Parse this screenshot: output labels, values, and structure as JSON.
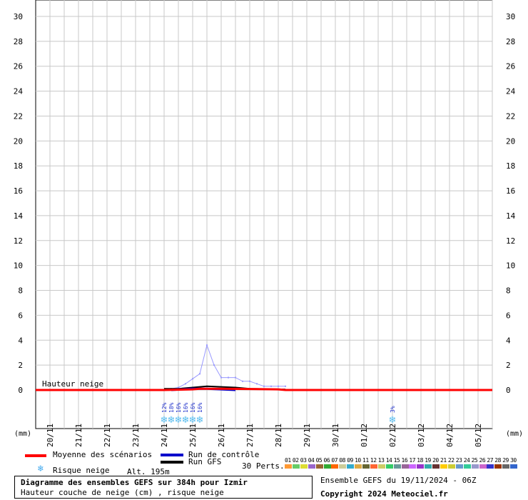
{
  "chart_data": {
    "type": "line",
    "title": "Diagramme des ensembles GEFS sur 384h pour Izmir",
    "subtitle": "Hauteur couche de neige (cm) , risque neige",
    "ylabel": "(mm)",
    "ylim": [
      0,
      30
    ],
    "yticks": [
      0,
      2,
      4,
      6,
      8,
      10,
      12,
      14,
      16,
      18,
      20,
      22,
      24,
      26,
      28,
      30
    ],
    "x_start_day": 19.5,
    "x_end_day": 35.5,
    "date_labels": [
      "20/11",
      "21/11",
      "22/11",
      "23/11",
      "24/11",
      "25/11",
      "26/11",
      "27/11",
      "28/11",
      "29/11",
      "30/11",
      "01/12",
      "02/12",
      "03/12",
      "04/12",
      "05/12"
    ],
    "inline_label": "Hauteur neige",
    "series": [
      {
        "name": "Moyenne des scénarios",
        "color": "#ff0000",
        "x": [
          19.5,
          24.0,
          25.0,
          25.25,
          25.5,
          26.0,
          27.0,
          28.0,
          28.25,
          35.5
        ],
        "y": [
          0,
          0,
          0.05,
          0.1,
          0.1,
          0.1,
          0.08,
          0.05,
          0,
          0
        ]
      },
      {
        "name": "Run de contrôle",
        "color": "#0000cc",
        "x": [
          24.25,
          25.0,
          25.5,
          26.0,
          26.5
        ],
        "y": [
          0,
          0.1,
          0.1,
          0.05,
          0
        ]
      },
      {
        "name": "Run GFS",
        "color": "#000000",
        "x": [
          24.0,
          24.5,
          25.0,
          25.25,
          25.5,
          26.0,
          26.5,
          27.0,
          28.25
        ],
        "y": [
          0.1,
          0.1,
          0.2,
          0.25,
          0.3,
          0.25,
          0.2,
          0.1,
          0.05
        ]
      },
      {
        "name": "max",
        "color": "#9999ff",
        "x": [
          24.0,
          24.25,
          24.5,
          24.75,
          25.0,
          25.25,
          25.5,
          25.75,
          26.0,
          26.25,
          26.5,
          26.75,
          27.0,
          27.25,
          27.5,
          27.75,
          28.0,
          28.25
        ],
        "y": [
          0,
          0.1,
          0.2,
          0.5,
          0.9,
          1.3,
          3.6,
          2.0,
          1.0,
          1.0,
          1.0,
          0.7,
          0.7,
          0.5,
          0.3,
          0.3,
          0.3,
          0.3
        ]
      }
    ],
    "snow_risk": [
      {
        "day": 24.0,
        "pct": "12%"
      },
      {
        "day": 24.25,
        "pct": "18%"
      },
      {
        "day": 24.5,
        "pct": "16%"
      },
      {
        "day": 24.75,
        "pct": "16%"
      },
      {
        "day": 25.0,
        "pct": "16%"
      },
      {
        "day": 25.25,
        "pct": "16%"
      },
      {
        "day": 32.0,
        "pct": "3%"
      }
    ]
  },
  "legend": {
    "mean": "Moyenne des scénarios",
    "control": "Run de contrôle",
    "gfs": "Run GFS",
    "perts": "30 Perts.",
    "snow_risk": "Risque neige",
    "altitude": "Alt. 195m"
  },
  "perturbations": [
    "01",
    "02",
    "03",
    "04",
    "05",
    "06",
    "07",
    "08",
    "09",
    "10",
    "11",
    "12",
    "13",
    "14",
    "15",
    "16",
    "17",
    "18",
    "19",
    "20",
    "21",
    "22",
    "23",
    "24",
    "25",
    "26",
    "27",
    "28",
    "29",
    "30"
  ],
  "pert_colors": [
    "#ff9933",
    "#66cc66",
    "#dddd33",
    "#9966cc",
    "#996633",
    "#33aa33",
    "#ff6600",
    "#cccc99",
    "#33aacc",
    "#ddaa44",
    "#666633",
    "#ff6633",
    "#cccc66",
    "#33cc66",
    "#669999",
    "#996699",
    "#cc66ff",
    "#9933cc",
    "#33aaaa",
    "#663333",
    "#ffcc00",
    "#cccc33",
    "#6699cc",
    "#33cc99",
    "#9999cc",
    "#cc66cc",
    "#3333cc",
    "#993300",
    "#666666",
    "#3366cc"
  ],
  "info": {
    "title_line1": "Diagramme des ensembles GEFS sur 384h pour Izmir",
    "title_line2": "Hauteur couche de neige (cm) , risque neige",
    "run": "Ensemble GEFS du 19/11/2024 - 06Z",
    "copyright": "Copyright 2024 Meteociel.fr"
  }
}
